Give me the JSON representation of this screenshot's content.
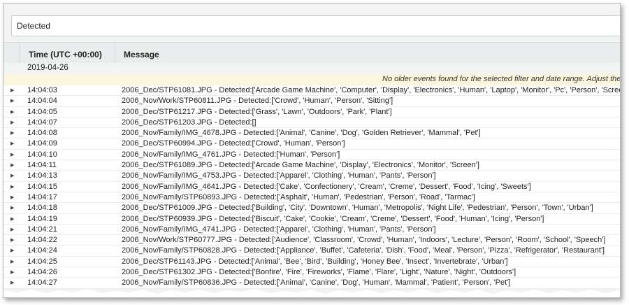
{
  "filter": {
    "value": "Detected"
  },
  "columns": {
    "time": "Time (UTC +00:00)",
    "message": "Message"
  },
  "date_group": "2019-04-26",
  "notice": "No older events found for the selected filter and date range. Adjust the",
  "rows": [
    {
      "time": "14:04:03",
      "message": "2006_Dec/STP61081.JPG - Detected:['Arcade Game Machine', 'Computer', 'Display', 'Electronics', 'Human', 'Laptop', 'Monitor', 'Pc', 'Person', 'Screen'"
    },
    {
      "time": "14:04:04",
      "message": "2006_Nov/Work/STP60811.JPG - Detected:['Crowd', 'Human', 'Person', 'Sitting']"
    },
    {
      "time": "14:04:05",
      "message": "2006_Dec/STP61217.JPG - Detected:['Grass', 'Lawn', 'Outdoors', 'Park', 'Plant']"
    },
    {
      "time": "14:04:07",
      "message": "2006_Dec/STP61203.JPG - Detected:[]"
    },
    {
      "time": "14:04:08",
      "message": "2006_Nov/Family/IMG_4678.JPG - Detected:['Animal', 'Canine', 'Dog', 'Golden Retriever', 'Mammal', 'Pet']"
    },
    {
      "time": "14:04:09",
      "message": "2006_Dec/STP60994.JPG - Detected:['Crowd', 'Human', 'Person']"
    },
    {
      "time": "14:04:10",
      "message": "2006_Nov/Family/IMG_4761.JPG - Detected:['Human', 'Person']"
    },
    {
      "time": "14:04:11",
      "message": "2006_Dec/STP61089.JPG - Detected:['Arcade Game Machine', 'Display', 'Electronics', 'Monitor', 'Screen']"
    },
    {
      "time": "14:04:13",
      "message": "2006_Nov/Family/IMG_4753.JPG - Detected:['Apparel', 'Clothing', 'Human', 'Pants', 'Person']"
    },
    {
      "time": "14:04:15",
      "message": "2006_Nov/Family/IMG_4641.JPG - Detected:['Cake', 'Confectionery', 'Cream', 'Creme', 'Dessert', 'Food', 'Icing', 'Sweets']"
    },
    {
      "time": "14:04:17",
      "message": "2006_Nov/Family/STP60893.JPG - Detected:['Asphalt', 'Human', 'Pedestrian', 'Person', 'Road', 'Tarmac']"
    },
    {
      "time": "14:04:18",
      "message": "2006_Dec/STP61009.JPG - Detected:['Building', 'City', 'Downtown', 'Human', 'Metropolis', 'Night Life', 'Pedestrian', 'Person', 'Town', 'Urban']"
    },
    {
      "time": "14:04:19",
      "message": "2006_Dec/STP60939.JPG - Detected:['Biscuit', 'Cake', 'Cookie', 'Cream', 'Creme', 'Dessert', 'Food', 'Human', 'Icing', 'Person']"
    },
    {
      "time": "14:04:21",
      "message": "2006_Nov/Family/IMG_4741.JPG - Detected:['Apparel', 'Clothing', 'Human', 'Pants', 'Person']"
    },
    {
      "time": "14:04:22",
      "message": "2006_Nov/Work/STP60777.JPG - Detected:['Audience', 'Classroom', 'Crowd', 'Human', 'Indoors', 'Lecture', 'Person', 'Room', 'School', 'Speech']"
    },
    {
      "time": "14:04:24",
      "message": "2006_Nov/Family/STP60828.JPG - Detected:['Appliance', 'Buffet', 'Cafeteria', 'Dish', 'Food', 'Meal', 'Person', 'Pizza', 'Refrigerator', 'Restaurant']"
    },
    {
      "time": "14:04:25",
      "message": "2006_Dec/STP61143.JPG - Detected:['Animal', 'Bee', 'Bird', 'Building', 'Honey Bee', 'Insect', 'Invertebrate', 'Urban']"
    },
    {
      "time": "14:04:26",
      "message": "2006_Dec/STP61302.JPG - Detected:['Bonfire', 'Fire', 'Fireworks', 'Flame', 'Flare', 'Light', 'Nature', 'Night', 'Outdoors']"
    },
    {
      "time": "14:04:27",
      "message": "2006_Nov/Family/STP60836.JPG - Detected:['Animal', 'Canine', 'Dog', 'Human', 'Mammal', 'Patient', 'Person', 'Pet']"
    }
  ]
}
